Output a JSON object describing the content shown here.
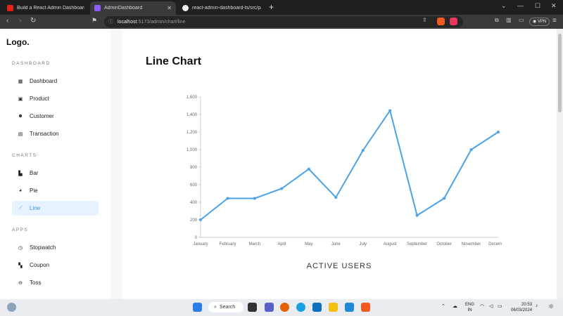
{
  "browser": {
    "tabs": [
      {
        "label": "Build a React Admin Dashboard App"
      },
      {
        "label": "AdminDashboard"
      },
      {
        "label": "react-admin-dashboard-ts/src/page"
      }
    ],
    "url_host": "localhost",
    "url_path": ":5173/admin/chart/line",
    "vpn_label": "VPN",
    "brave_badge": "2"
  },
  "sidebar": {
    "logo": "Logo.",
    "sections": [
      {
        "title": "DASHBOARD",
        "items": [
          {
            "label": "Dashboard",
            "icon": "dashboard-icon"
          },
          {
            "label": "Product",
            "icon": "bag-icon"
          },
          {
            "label": "Customer",
            "icon": "users-icon"
          },
          {
            "label": "Transaction",
            "icon": "document-icon"
          }
        ]
      },
      {
        "title": "CHARTS",
        "items": [
          {
            "label": "Bar",
            "icon": "bar-chart-icon"
          },
          {
            "label": "Pie",
            "icon": "pie-chart-icon"
          },
          {
            "label": "Line",
            "icon": "line-chart-icon",
            "active": true
          }
        ]
      },
      {
        "title": "APPS",
        "items": [
          {
            "label": "Stopwatch",
            "icon": "stopwatch-icon"
          },
          {
            "label": "Coupon",
            "icon": "coupon-icon"
          },
          {
            "label": "Toss",
            "icon": "coin-icon"
          }
        ]
      }
    ]
  },
  "main": {
    "title": "Line Chart",
    "caption": "ACTIVE USERS"
  },
  "chart_data": {
    "type": "line",
    "categories": [
      "January",
      "February",
      "March",
      "April",
      "May",
      "June",
      "July",
      "August",
      "September",
      "October",
      "November",
      "December"
    ],
    "series": [
      {
        "values": [
          200,
          444,
          444,
          556,
          778,
          455,
          990,
          1444,
          250,
          444,
          999,
          1200
        ]
      }
    ],
    "yticks": [
      "0",
      "200",
      "400",
      "600",
      "800",
      "1,000",
      "1,200",
      "1,400",
      "1,600"
    ],
    "ylim": [
      0,
      1600
    ],
    "color": "#4aa3e8",
    "grid": false
  },
  "taskbar": {
    "search_label": "Search",
    "lang": "ENG",
    "region": "IN",
    "time": "20:53",
    "date": "06/03/2024"
  }
}
